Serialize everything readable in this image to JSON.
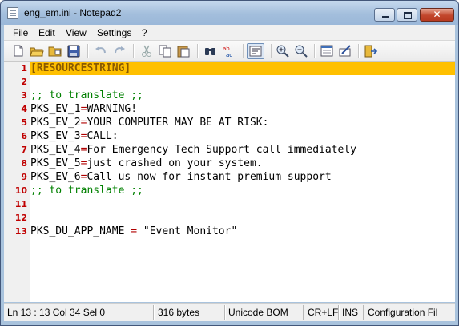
{
  "window": {
    "title": "eng_em.ini - Notepad2",
    "close_glyph": "✕"
  },
  "menu": {
    "items": [
      "File",
      "Edit",
      "View",
      "Settings",
      "?"
    ]
  },
  "toolbar": {
    "icons": [
      "new-file-icon",
      "open-folder-icon",
      "browse-icon",
      "save-icon",
      "undo-icon",
      "redo-icon",
      "cut-icon",
      "copy-icon",
      "paste-icon",
      "find-icon",
      "replace-icon",
      "word-wrap-icon",
      "zoom-in-icon",
      "zoom-out-icon",
      "scheme-icon",
      "customize-icon",
      "exit-icon"
    ]
  },
  "editor": {
    "current_line": 1,
    "lines": [
      {
        "num": "1",
        "parts": [
          {
            "cls": "section",
            "text": "[RESOURCESTRING]"
          }
        ]
      },
      {
        "num": "2",
        "parts": []
      },
      {
        "num": "3",
        "parts": [
          {
            "cls": "comment",
            "text": ";; to translate ;;"
          }
        ]
      },
      {
        "num": "4",
        "parts": [
          {
            "cls": "key",
            "text": "PKS_EV_1"
          },
          {
            "cls": "eq",
            "text": "="
          },
          {
            "cls": "val",
            "text": "WARNING!"
          }
        ]
      },
      {
        "num": "5",
        "parts": [
          {
            "cls": "key",
            "text": "PKS_EV_2"
          },
          {
            "cls": "eq",
            "text": "="
          },
          {
            "cls": "val",
            "text": "YOUR COMPUTER MAY BE AT RISK:"
          }
        ]
      },
      {
        "num": "6",
        "parts": [
          {
            "cls": "key",
            "text": "PKS_EV_3"
          },
          {
            "cls": "eq",
            "text": "="
          },
          {
            "cls": "val",
            "text": "CALL:"
          }
        ]
      },
      {
        "num": "7",
        "parts": [
          {
            "cls": "key",
            "text": "PKS_EV_4"
          },
          {
            "cls": "eq",
            "text": "="
          },
          {
            "cls": "val",
            "text": "For Emergency Tech Support call immediately"
          }
        ]
      },
      {
        "num": "8",
        "parts": [
          {
            "cls": "key",
            "text": "PKS_EV_5"
          },
          {
            "cls": "eq",
            "text": "="
          },
          {
            "cls": "val",
            "text": "just crashed on your system."
          }
        ]
      },
      {
        "num": "9",
        "parts": [
          {
            "cls": "key",
            "text": "PKS_EV_6"
          },
          {
            "cls": "eq",
            "text": "="
          },
          {
            "cls": "val",
            "text": "Call us now for instant premium support"
          }
        ]
      },
      {
        "num": "10",
        "parts": [
          {
            "cls": "comment",
            "text": ";; to translate ;;"
          }
        ]
      },
      {
        "num": "11",
        "parts": []
      },
      {
        "num": "12",
        "parts": []
      },
      {
        "num": "13",
        "parts": [
          {
            "cls": "key",
            "text": "PKS_DU_APP_NAME "
          },
          {
            "cls": "eq",
            "text": "="
          },
          {
            "cls": "val",
            "text": " \"Event Monitor\""
          }
        ]
      }
    ]
  },
  "statusbar": {
    "position": "Ln 13 : 13   Col 34   Sel 0",
    "size": "316 bytes",
    "encoding": "Unicode BOM",
    "line_endings": "CR+LF",
    "mode": "INS",
    "scheme": "Configuration Fil"
  },
  "colors": {
    "current_line_highlight": "#ffc000",
    "line_number": "#c00000",
    "comment": "#008000",
    "section": "#8a5a00"
  }
}
